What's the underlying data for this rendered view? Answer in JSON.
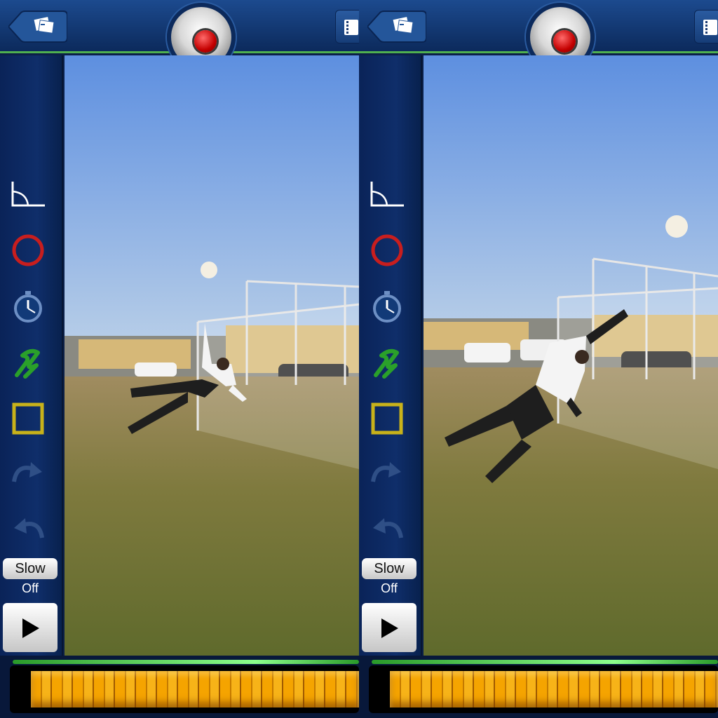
{
  "colors": {
    "accent_green": "#4fb04f",
    "record_red": "#c40000",
    "toolbar_blue": "#1c4a8e",
    "timeline_orange": "#f5a400"
  },
  "panels": [
    {
      "id": "left",
      "toolbar": {
        "back_icon": "photo-library-icon",
        "record_icon": "record-icon",
        "film_icon": "film-strip-icon"
      },
      "tools": [
        {
          "name": "angle-tool-icon",
          "color": "#ffffff"
        },
        {
          "name": "circle-tool-icon",
          "color": "#c81e1e"
        },
        {
          "name": "timer-tool-icon",
          "color": "#3b7bd8"
        },
        {
          "name": "freehand-tool-icon",
          "color": "#2aa02a"
        },
        {
          "name": "rectangle-tool-icon",
          "color": "#c8b21a"
        },
        {
          "name": "redo-icon",
          "color": "#2f4f86"
        },
        {
          "name": "undo-icon",
          "color": "#2f4f86"
        }
      ],
      "slow_label": "Slow",
      "slow_state": "Off",
      "play_icon": "play-icon"
    },
    {
      "id": "right",
      "toolbar": {
        "back_icon": "photo-library-icon",
        "record_icon": "record-icon",
        "film_icon": "film-strip-icon"
      },
      "tools": [
        {
          "name": "angle-tool-icon",
          "color": "#ffffff"
        },
        {
          "name": "circle-tool-icon",
          "color": "#c81e1e"
        },
        {
          "name": "timer-tool-icon",
          "color": "#3b7bd8"
        },
        {
          "name": "freehand-tool-icon",
          "color": "#2aa02a"
        },
        {
          "name": "rectangle-tool-icon",
          "color": "#c8b21a"
        },
        {
          "name": "redo-icon",
          "color": "#2f4f86"
        },
        {
          "name": "undo-icon",
          "color": "#2f4f86"
        }
      ],
      "slow_label": "Slow",
      "slow_state": "Off",
      "play_icon": "play-icon"
    }
  ]
}
